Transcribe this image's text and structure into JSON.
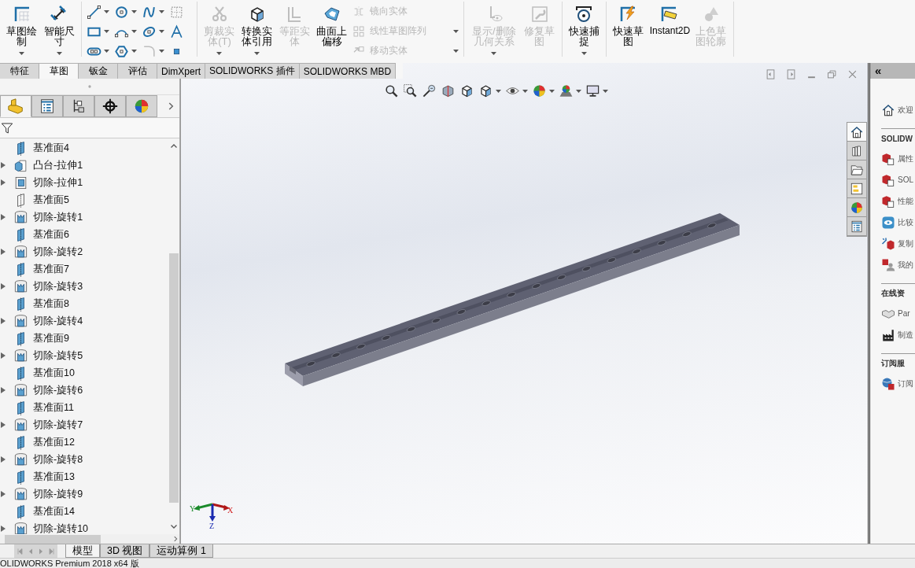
{
  "toolbar": {
    "groups": [
      [
        {
          "kind": "big",
          "label": "草图绘制",
          "disabled": false,
          "dropdown": true
        },
        {
          "kind": "big",
          "label": "智能尺寸",
          "disabled": false,
          "dropdown": true
        }
      ],
      [
        {
          "kind": "grid",
          "tools": [
            {
              "disabled": false,
              "dropdown": true
            },
            {
              "disabled": false,
              "dropdown": true
            },
            {
              "disabled": false,
              "dropdown": true
            },
            {
              "disabled": false,
              "dropdown": false
            },
            {
              "disabled": false,
              "dropdown": true
            },
            {
              "disabled": false,
              "dropdown": true
            },
            {
              "disabled": false,
              "dropdown": true
            },
            {
              "disabled": false,
              "dropdown": false
            },
            {
              "disabled": false,
              "dropdown": true
            },
            {
              "disabled": false,
              "dropdown": true
            },
            {
              "disabled": true,
              "dropdown": true
            },
            {
              "disabled": false,
              "dropdown": false
            }
          ]
        }
      ],
      [
        {
          "kind": "big",
          "label": "剪裁实体(T)",
          "disabled": true,
          "dropdown": true
        },
        {
          "kind": "big",
          "label": "转换实体引用",
          "disabled": false,
          "dropdown": true
        },
        {
          "kind": "big",
          "label": "等距实体",
          "disabled": true,
          "dropdown": false
        },
        {
          "kind": "big",
          "label": "曲面上偏移",
          "disabled": false,
          "dropdown": false
        },
        {
          "kind": "list",
          "rows": [
            {
              "label": "镜向实体",
              "disabled": true,
              "dropdown": false
            },
            {
              "label": "线性草图阵列",
              "disabled": true,
              "dropdown": true
            },
            {
              "label": "移动实体",
              "disabled": true,
              "dropdown": true
            }
          ]
        }
      ],
      [
        {
          "kind": "big",
          "label": "显示/删除几何关系",
          "disabled": true,
          "dropdown": true
        },
        {
          "kind": "big",
          "label": "修复草图",
          "disabled": true,
          "dropdown": false
        }
      ],
      [
        {
          "kind": "big",
          "label": "快速捕捉",
          "disabled": false,
          "dropdown": true
        }
      ],
      [
        {
          "kind": "big",
          "label": "快速草图",
          "disabled": false,
          "dropdown": false
        },
        {
          "kind": "big",
          "label": "Instant2D",
          "disabled": false,
          "dropdown": false
        },
        {
          "kind": "big",
          "label": "上色草图轮廓",
          "disabled": true,
          "dropdown": false
        }
      ]
    ]
  },
  "command_tabs": [
    {
      "label": "特征",
      "selected": false
    },
    {
      "label": "草图",
      "selected": true
    },
    {
      "label": "钣金",
      "selected": false
    },
    {
      "label": "评估",
      "selected": false
    },
    {
      "label": "DimXpert",
      "selected": false
    },
    {
      "label": "SOLIDWORKS 插件",
      "selected": false
    },
    {
      "label": "SOLIDWORKS MBD",
      "selected": false
    }
  ],
  "manager_tabs": [
    {
      "selected": true
    },
    {
      "selected": false
    },
    {
      "selected": false
    },
    {
      "selected": false
    },
    {
      "selected": false
    }
  ],
  "feature_tree": {
    "items": [
      {
        "label": "基准面4",
        "kind": "plane",
        "expandable": false
      },
      {
        "label": "凸台-拉伸1",
        "kind": "boss",
        "expandable": true
      },
      {
        "label": "切除-拉伸1",
        "kind": "cut-extrude",
        "expandable": true
      },
      {
        "label": "基准面5",
        "kind": "plane-hidden",
        "expandable": false
      },
      {
        "label": "切除-旋转1",
        "kind": "cut-revolve",
        "expandable": true
      },
      {
        "label": "基准面6",
        "kind": "plane",
        "expandable": false
      },
      {
        "label": "切除-旋转2",
        "kind": "cut-revolve",
        "expandable": true
      },
      {
        "label": "基准面7",
        "kind": "plane",
        "expandable": false
      },
      {
        "label": "切除-旋转3",
        "kind": "cut-revolve",
        "expandable": true
      },
      {
        "label": "基准面8",
        "kind": "plane",
        "expandable": false
      },
      {
        "label": "切除-旋转4",
        "kind": "cut-revolve",
        "expandable": true
      },
      {
        "label": "基准面9",
        "kind": "plane",
        "expandable": false
      },
      {
        "label": "切除-旋转5",
        "kind": "cut-revolve",
        "expandable": true
      },
      {
        "label": "基准面10",
        "kind": "plane",
        "expandable": false
      },
      {
        "label": "切除-旋转6",
        "kind": "cut-revolve",
        "expandable": true
      },
      {
        "label": "基准面11",
        "kind": "plane",
        "expandable": false
      },
      {
        "label": "切除-旋转7",
        "kind": "cut-revolve",
        "expandable": true
      },
      {
        "label": "基准面12",
        "kind": "plane",
        "expandable": false
      },
      {
        "label": "切除-旋转8",
        "kind": "cut-revolve",
        "expandable": true
      },
      {
        "label": "基准面13",
        "kind": "plane",
        "expandable": false
      },
      {
        "label": "切除-旋转9",
        "kind": "cut-revolve",
        "expandable": true
      },
      {
        "label": "基准面14",
        "kind": "plane",
        "expandable": false
      },
      {
        "label": "切除-旋转10",
        "kind": "cut-revolve",
        "expandable": true
      }
    ]
  },
  "viewport": {
    "task_tabs": [
      {
        "selected": true
      },
      {
        "selected": false
      },
      {
        "selected": false
      },
      {
        "selected": false
      },
      {
        "selected": false
      },
      {
        "selected": false
      }
    ],
    "triad": {
      "x": "X",
      "y": "Y",
      "z": "Z"
    }
  },
  "task_pane": {
    "collapse": "«",
    "items": [
      {
        "kind": "link",
        "label": "欢迎"
      },
      {
        "kind": "heading",
        "label": "SOLIDW"
      },
      {
        "kind": "link",
        "label": "属性"
      },
      {
        "kind": "link",
        "label": "SOL"
      },
      {
        "kind": "link",
        "label": "性能"
      },
      {
        "kind": "link",
        "label": "比较"
      },
      {
        "kind": "link",
        "label": "复制"
      },
      {
        "kind": "link",
        "label": "我的"
      },
      {
        "kind": "heading",
        "label": "在线资"
      },
      {
        "kind": "link",
        "label": "Par"
      },
      {
        "kind": "link",
        "label": "制造"
      },
      {
        "kind": "heading",
        "label": "订阅服"
      },
      {
        "kind": "link",
        "label": "订阅"
      }
    ]
  },
  "bottom_tabs": [
    {
      "label": "模型",
      "selected": true
    },
    {
      "label": "3D 视图",
      "selected": false
    },
    {
      "label": "运动算例 1",
      "selected": false
    }
  ],
  "status_bar": {
    "text": "OLIDWORKS Premium 2018 x64 版"
  }
}
